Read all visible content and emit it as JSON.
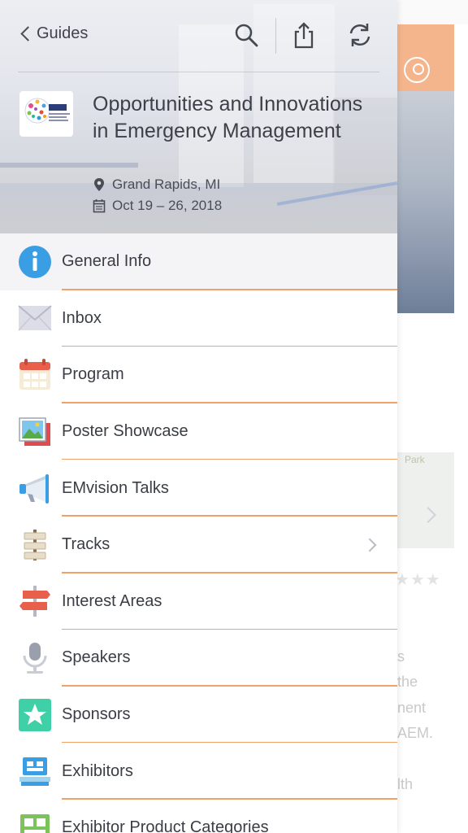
{
  "nav": {
    "back_label": "Guides"
  },
  "toolbar": {
    "search_icon": "search-icon",
    "share_icon": "share-icon",
    "refresh_icon": "refresh-icon"
  },
  "event": {
    "title": "Opportunities and Innovations in Emergency Management",
    "location": "Grand Rapids, MI",
    "dates": "Oct 19 – 26, 2018"
  },
  "menu": {
    "items": [
      {
        "label": "General Info",
        "icon": "info-icon",
        "active": true
      },
      {
        "label": "Inbox",
        "icon": "envelope-icon"
      },
      {
        "label": "Program",
        "icon": "calendar-icon"
      },
      {
        "label": "Poster Showcase",
        "icon": "picture-icon"
      },
      {
        "label": "EMvision Talks",
        "icon": "megaphone-icon"
      },
      {
        "label": "Tracks",
        "icon": "signpost-icon",
        "has_chevron": true
      },
      {
        "label": "Interest Areas",
        "icon": "direction-sign-icon"
      },
      {
        "label": "Speakers",
        "icon": "microphone-icon"
      },
      {
        "label": "Sponsors",
        "icon": "star-icon"
      },
      {
        "label": "Exhibitors",
        "icon": "booth-icon"
      },
      {
        "label": "Exhibitor Product Categories",
        "icon": "storefront-icon"
      }
    ]
  },
  "background_page": {
    "map_label": "Park",
    "text_fragments": [
      "s",
      "the",
      "nent",
      "AEM.",
      "lth"
    ]
  },
  "colors": {
    "accent": "#f0a16b",
    "info_blue": "#3a9ee4",
    "text": "#3a3d44"
  }
}
